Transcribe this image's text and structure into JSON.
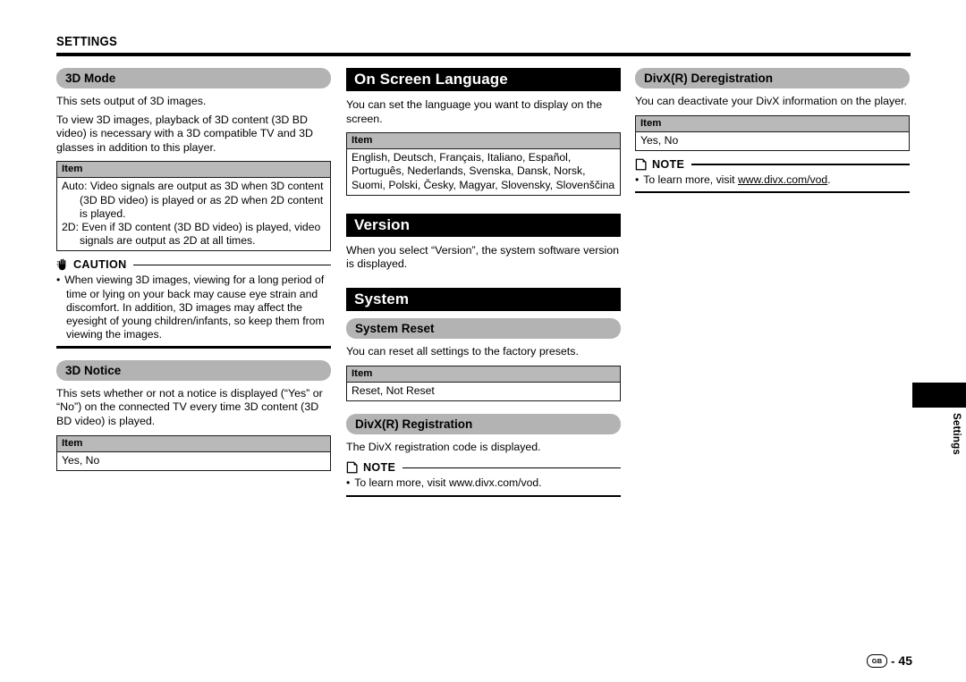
{
  "page": {
    "title": "SETTINGS",
    "side_tab_label": "Settings",
    "footer_region": "GB",
    "footer_separator": "-",
    "footer_page_number": "45"
  },
  "columns": {
    "left": {
      "mode_section": {
        "heading": "3D Mode",
        "paragraphs": [
          "This sets output of 3D images.",
          "To view 3D images, playback of 3D content (3D BD video) is necessary with a 3D compatible TV and 3D glasses in addition to this player."
        ],
        "table": {
          "header": "Item",
          "rows": [
            "Auto: Video signals are output as 3D when 3D content (3D BD video) is played or as 2D when 2D content is played.",
            "2D: Even if 3D content (3D BD video) is played, video signals are output as 2D at all times."
          ]
        },
        "caution": {
          "label": "CAUTION",
          "icon": "hand-icon",
          "items": [
            "When viewing 3D images, viewing for a long period of time or lying on your back may cause eye strain and discomfort. In addition, 3D images may affect the eyesight of young children/infants, so keep them from viewing the images."
          ]
        }
      },
      "notice_section": {
        "heading": "3D Notice",
        "paragraphs": [
          "This sets whether or not a notice is displayed (“Yes” or “No”) on the connected TV every time 3D content (3D BD video) is played."
        ],
        "table": {
          "header": "Item",
          "rows": [
            "Yes, No"
          ]
        }
      }
    },
    "middle": {
      "language_section": {
        "heading": "On Screen Language",
        "paragraphs": [
          "You can set the language you want to display on the screen."
        ],
        "table": {
          "header": "Item",
          "rows": [
            "English, Deutsch, Français, Italiano, Español, Português, Nederlands, Svenska, Dansk, Norsk, Suomi, Polski, Česky, Magyar, Slovensky, Slovenščina"
          ]
        }
      },
      "version_section": {
        "heading": "Version",
        "paragraphs": [
          "When you select “Version”, the system software version is displayed."
        ]
      },
      "system_section": {
        "heading": "System",
        "system_reset": {
          "heading": "System Reset",
          "paragraphs": [
            "You can reset all settings to the factory presets."
          ],
          "table": {
            "header": "Item",
            "rows": [
              "Reset, Not Reset"
            ]
          }
        },
        "divx_registration": {
          "heading": "DivX(R) Registration",
          "paragraphs": [
            "The DivX registration code is displayed."
          ],
          "note": {
            "label": "NOTE",
            "icon": "note-icon",
            "items": [
              "To learn more, visit www.divx.com/vod."
            ]
          }
        }
      }
    },
    "right": {
      "divx_deregistration": {
        "heading": "DivX(R) Deregistration",
        "paragraphs": [
          "You can deactivate your DivX information on the player."
        ],
        "table": {
          "header": "Item",
          "rows": [
            "Yes, No"
          ]
        },
        "note": {
          "label": "NOTE",
          "icon": "note-icon",
          "items_prefix": "To learn more, visit ",
          "items_link": "www.divx.com/vod",
          "items_suffix": "."
        }
      }
    }
  }
}
